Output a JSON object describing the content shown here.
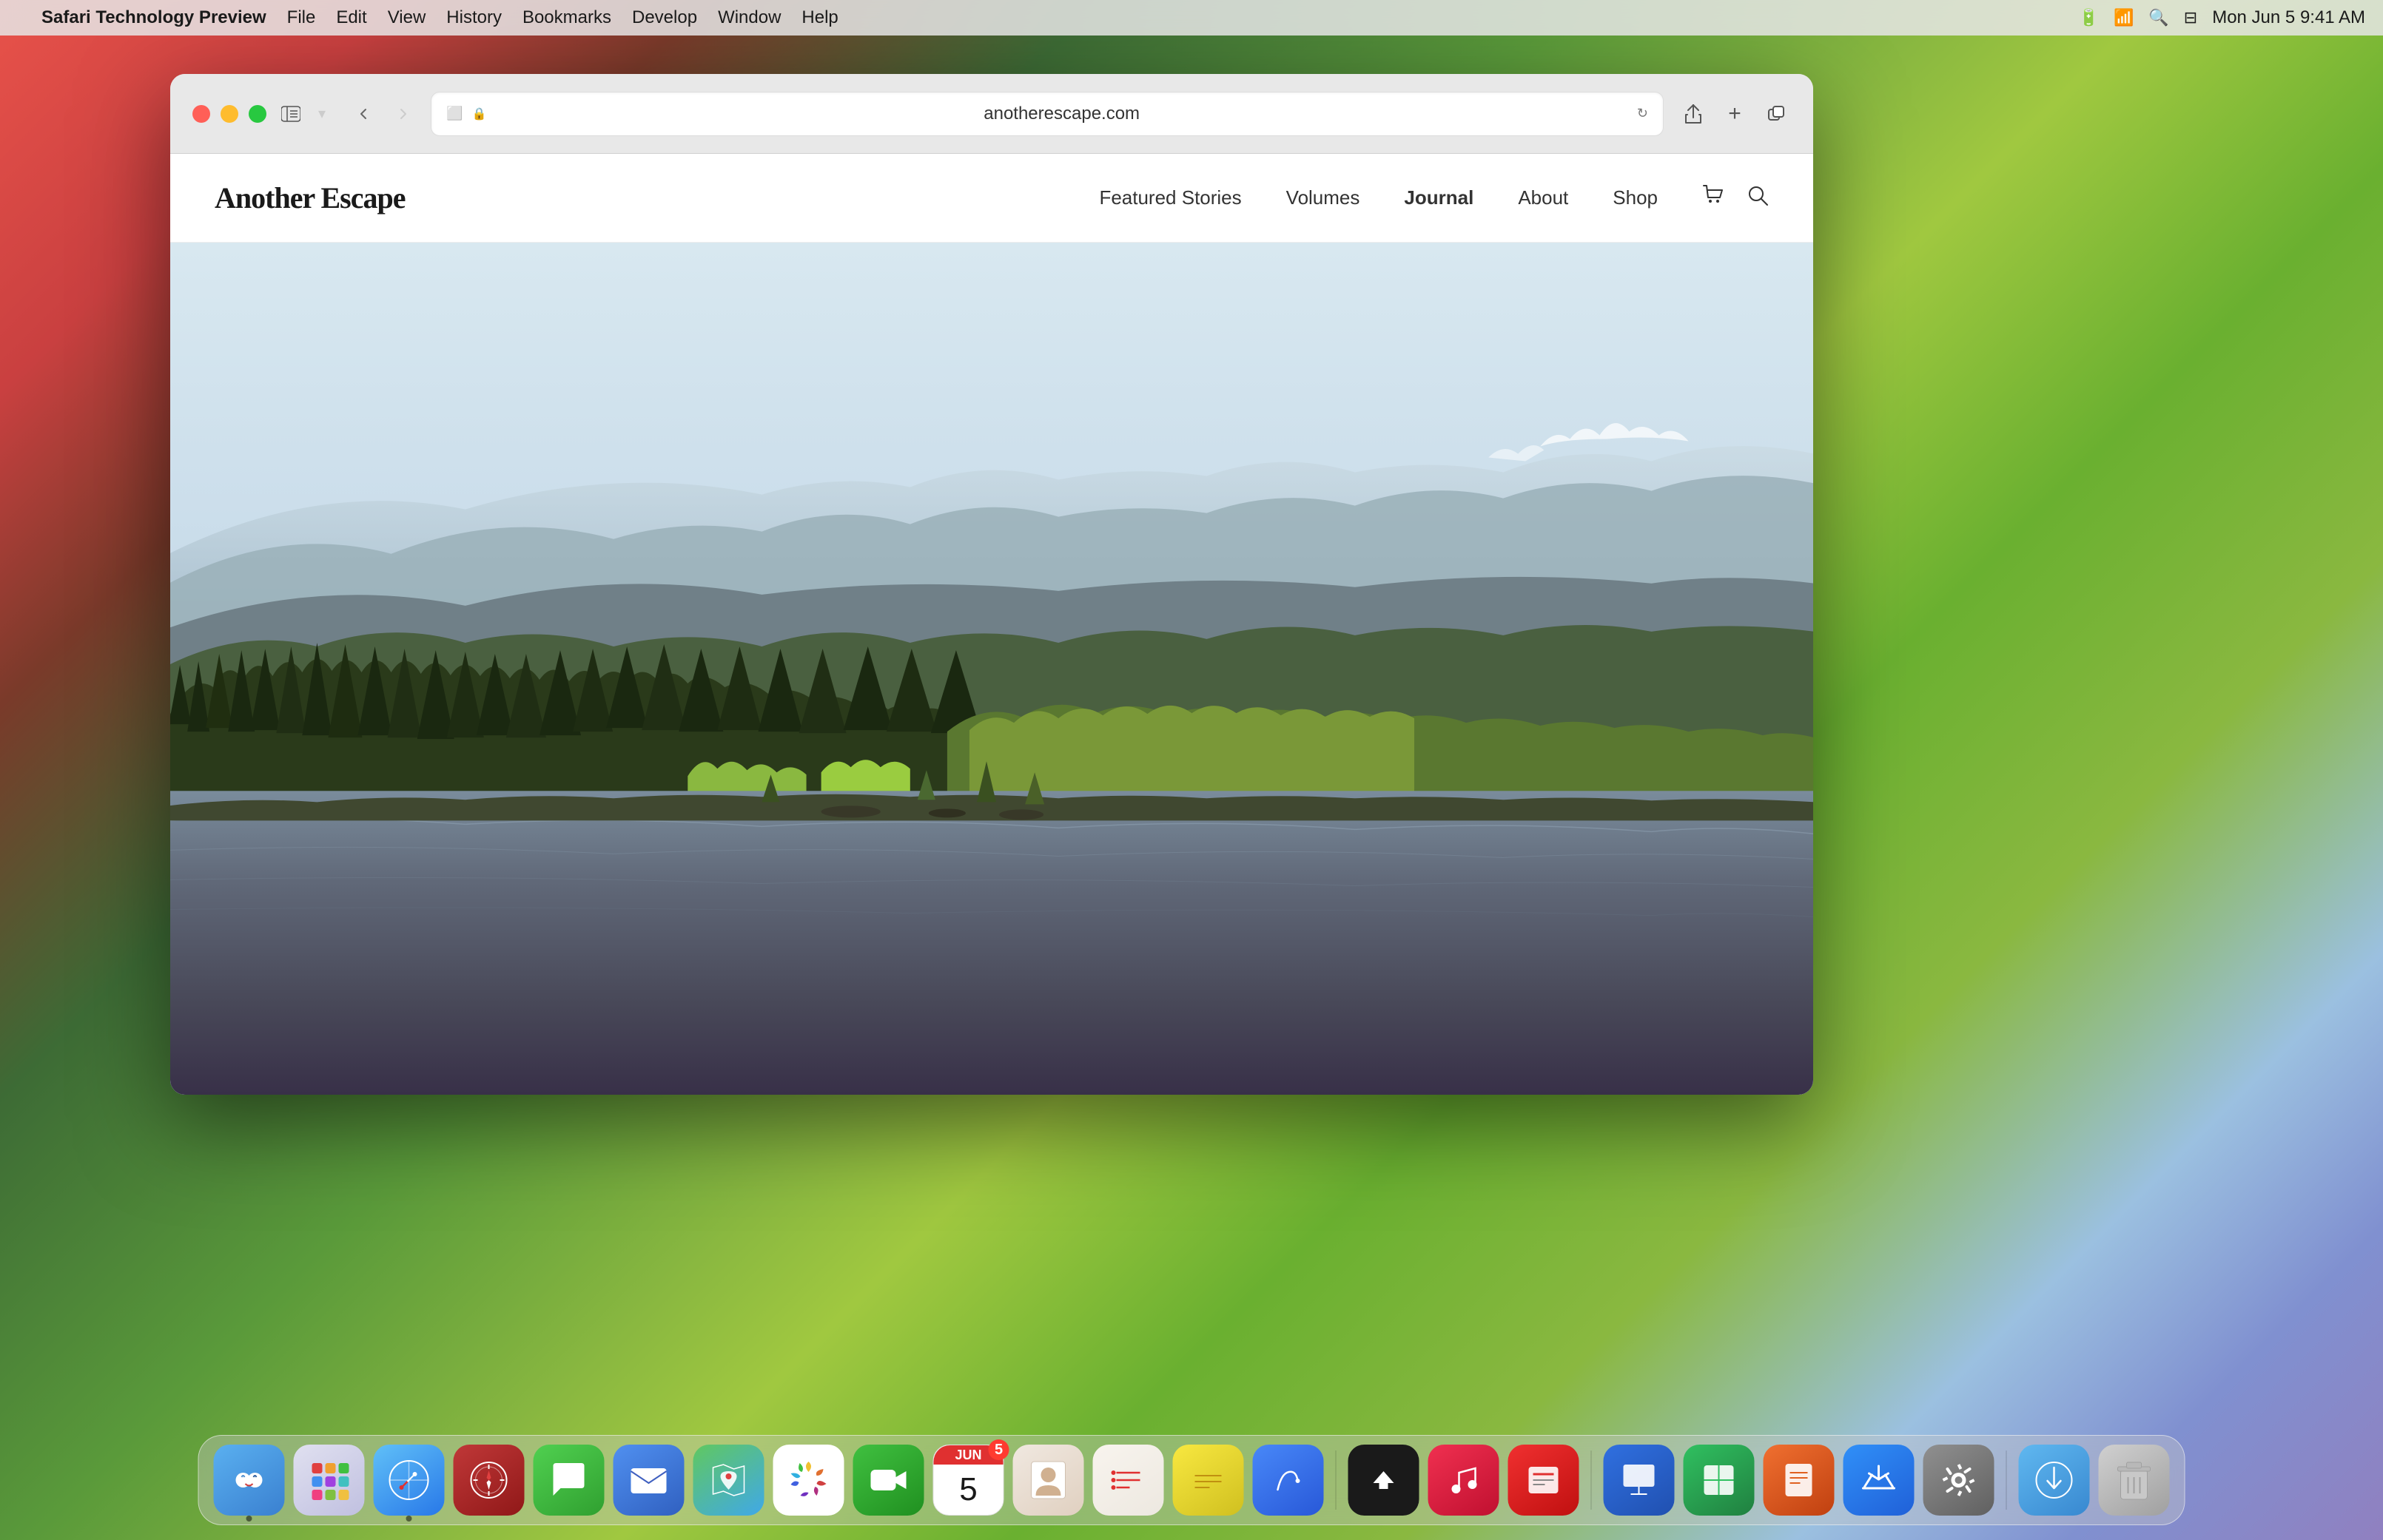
{
  "os": {
    "menu_bar": {
      "apple_symbol": "",
      "app_name": "Safari Technology Preview",
      "items": [
        "File",
        "Edit",
        "View",
        "History",
        "Bookmarks",
        "Develop",
        "Window",
        "Help"
      ],
      "time": "Mon Jun 5  9:41 AM"
    }
  },
  "browser": {
    "controls": {
      "back": "‹",
      "forward": "›"
    },
    "address_bar": {
      "url": "anotherescape.com",
      "lock_icon": "🔒"
    },
    "actions": {
      "share": "↑",
      "new_tab": "+",
      "tabs": "⊡"
    }
  },
  "website": {
    "logo": "Another Escape",
    "nav": {
      "items": [
        {
          "label": "Featured Stories",
          "active": false
        },
        {
          "label": "Volumes",
          "active": false
        },
        {
          "label": "Journal",
          "active": true
        },
        {
          "label": "About",
          "active": false
        },
        {
          "label": "Shop",
          "active": false
        }
      ]
    }
  },
  "dock": {
    "apps": [
      {
        "name": "Finder",
        "emoji": "🙂",
        "class": "dock-finder",
        "dot": true
      },
      {
        "name": "Launchpad",
        "emoji": "⚡",
        "class": "dock-launchpad",
        "dot": false
      },
      {
        "name": "Safari",
        "emoji": "🧭",
        "class": "dock-safari",
        "dot": true
      },
      {
        "name": "Compass",
        "emoji": "🧭",
        "class": "dock-compass",
        "dot": false
      },
      {
        "name": "Messages",
        "emoji": "💬",
        "class": "dock-messages",
        "dot": false
      },
      {
        "name": "Mail",
        "emoji": "✉️",
        "class": "dock-mail",
        "dot": false
      },
      {
        "name": "Maps",
        "emoji": "🗺",
        "class": "dock-maps",
        "dot": false
      },
      {
        "name": "Photos",
        "emoji": "🖼",
        "class": "dock-photos",
        "dot": false
      },
      {
        "name": "FaceTime",
        "emoji": "📹",
        "class": "dock-facetime",
        "dot": false
      },
      {
        "name": "Calendar",
        "emoji": "📅",
        "class": "dock-calendar",
        "dot": false,
        "badge": "5"
      },
      {
        "name": "Contacts",
        "emoji": "👤",
        "class": "dock-contacts",
        "dot": false
      },
      {
        "name": "Reminders",
        "emoji": "📋",
        "class": "dock-reminders",
        "dot": false
      },
      {
        "name": "Notes",
        "emoji": "📝",
        "class": "dock-notes",
        "dot": false
      },
      {
        "name": "Freeform",
        "emoji": "✏️",
        "class": "dock-freeform",
        "dot": false
      },
      {
        "name": "Apple TV",
        "emoji": "📺",
        "class": "dock-appletv",
        "dot": false
      },
      {
        "name": "Music",
        "emoji": "🎵",
        "class": "dock-music",
        "dot": false
      },
      {
        "name": "News",
        "emoji": "📰",
        "class": "dock-news",
        "dot": false
      },
      {
        "name": "Keynote",
        "emoji": "📊",
        "class": "dock-keynote",
        "dot": false
      },
      {
        "name": "Numbers",
        "emoji": "📈",
        "class": "dock-numbers",
        "dot": false
      },
      {
        "name": "Pages",
        "emoji": "📄",
        "class": "dock-pages",
        "dot": false
      },
      {
        "name": "App Store",
        "emoji": "🅐",
        "class": "dock-appstore",
        "dot": false
      },
      {
        "name": "System Settings",
        "emoji": "⚙️",
        "class": "dock-settings",
        "dot": false
      },
      {
        "name": "Downloads",
        "emoji": "⬇️",
        "class": "dock-download",
        "dot": false
      },
      {
        "name": "Trash",
        "emoji": "🗑",
        "class": "dock-trash",
        "dot": false
      }
    ]
  }
}
